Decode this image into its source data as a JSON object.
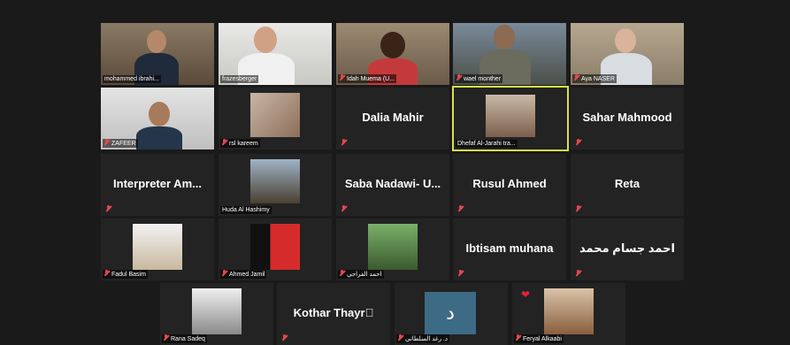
{
  "participants": [
    {
      "name": "mohammed ibrahi...",
      "muted": false
    },
    {
      "name": "frazesberger",
      "muted": false
    },
    {
      "name": "Idah Muema (U...",
      "muted": true
    },
    {
      "name": "wael monther",
      "muted": true
    },
    {
      "name": "Aya NASER",
      "muted": true
    },
    {
      "name": "ZAFEER",
      "muted": true
    },
    {
      "name": "rsl kareem",
      "muted": true
    },
    {
      "name": "Dalia Mahir",
      "muted": true
    },
    {
      "name": "Dhefaf Al-Jarahi tra...",
      "muted": false
    },
    {
      "name": "Sahar Mahmood",
      "muted": true
    },
    {
      "name": "Interpreter  Am...",
      "muted": true
    },
    {
      "name": "Huda Al Hashimy",
      "muted": false
    },
    {
      "name": "Saba Nadawi- U...",
      "muted": true
    },
    {
      "name": "Rusul Ahmed",
      "muted": true
    },
    {
      "name": "Reta",
      "muted": true
    },
    {
      "name": "Fadul Basim",
      "muted": true
    },
    {
      "name": "Ahmed Jamil",
      "muted": true
    },
    {
      "name": "احمد الفراجي",
      "muted": true
    },
    {
      "name": "Ibtisam muhana",
      "muted": true
    },
    {
      "name": "احمد جسام محمد",
      "muted": true
    },
    {
      "name": "Rana Sadeq",
      "muted": true
    },
    {
      "name": "Kothar  Thayr\u0000",
      "muted": true
    },
    {
      "name": "د. رغد السلطاني",
      "muted": true,
      "avatar_letter": "د"
    },
    {
      "name": "Feryal Alkaabi",
      "muted": true,
      "reaction": "heart"
    }
  ],
  "colors": {
    "active_border": "#d8df4f",
    "mic_muted": "#e5484d"
  }
}
